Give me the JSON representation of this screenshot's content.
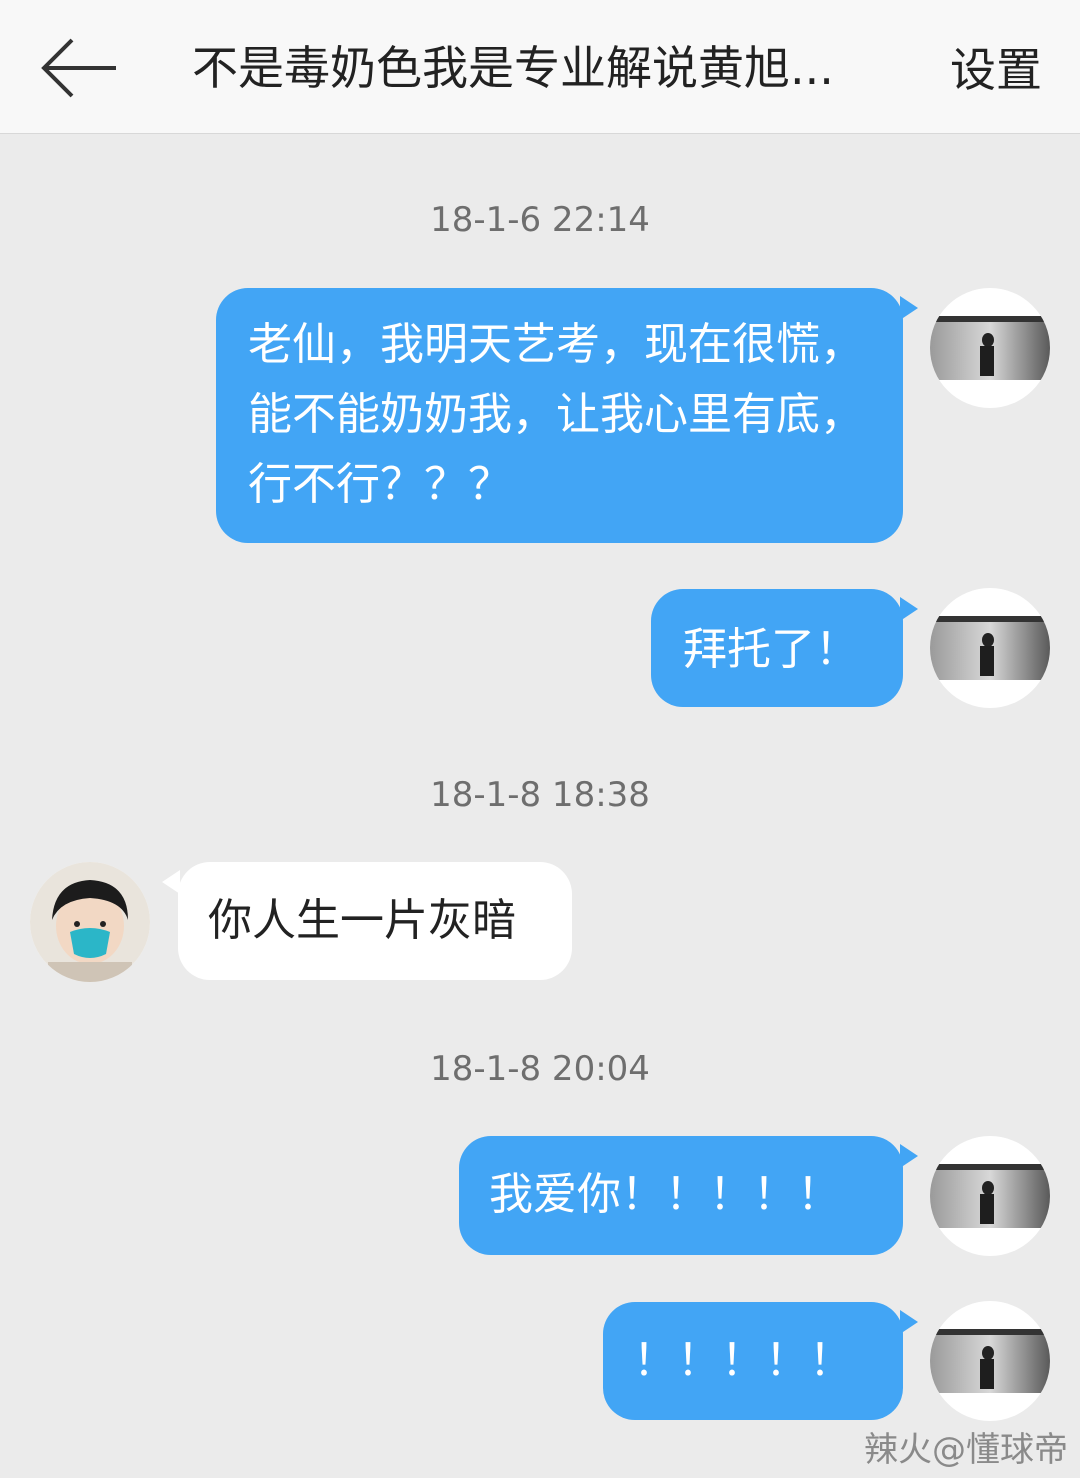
{
  "header": {
    "title": "不是毒奶色我是专业解说黄旭...",
    "settings_label": "设置",
    "back_icon": "back-arrow-icon"
  },
  "messages": {
    "ts1": "18-1-6 22:14",
    "m1": "老仙，我明天艺考，现在很慌，能不能奶奶我，让我心里有底，行不行？？？",
    "m2": "拜托了！",
    "ts2": "18-1-8 18:38",
    "m3": "你人生一片灰暗",
    "ts3": "18-1-8 20:04",
    "m4": "我爱你！！！！！",
    "m5": "！！！！！"
  },
  "watermark": "辣火@懂球帝",
  "colors": {
    "outgoing_bubble": "#42a5f5",
    "incoming_bubble": "#ffffff",
    "background": "#ebebeb"
  }
}
